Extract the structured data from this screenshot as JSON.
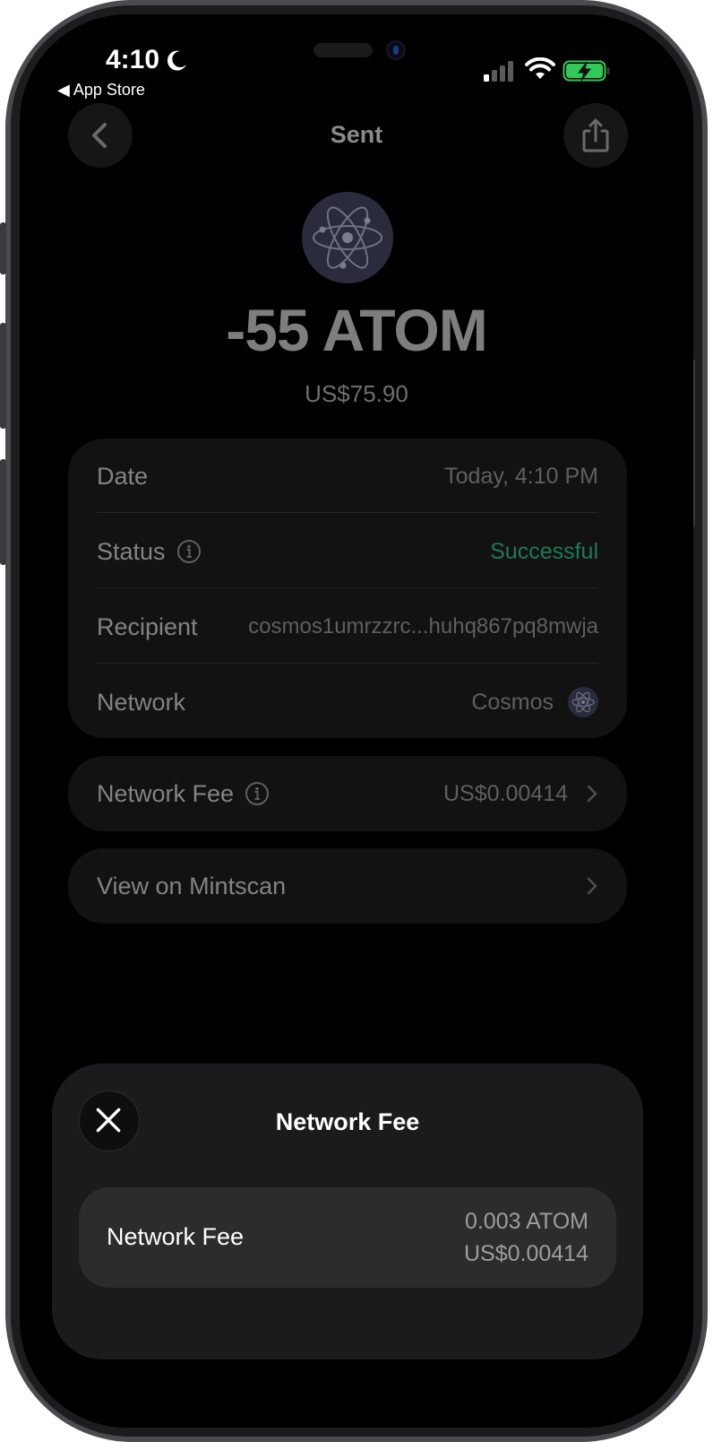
{
  "status_bar": {
    "time": "4:10",
    "back_app": "◀ App Store",
    "battery_color": "#34c759"
  },
  "header": {
    "title": "Sent"
  },
  "transaction": {
    "amount": "-55 ATOM",
    "fiat_amount": "US$75.90"
  },
  "details": {
    "date_label": "Date",
    "date_value": "Today, 4:10 PM",
    "status_label": "Status",
    "status_value": "Successful",
    "status_color": "#1e7a55",
    "recipient_label": "Recipient",
    "recipient_value": "cosmos1umrzzrc...huhq867pq8mwja",
    "network_label": "Network",
    "network_value": "Cosmos"
  },
  "fee_row": {
    "label": "Network Fee",
    "value": "US$0.00414"
  },
  "explorer_row": {
    "label": "View on Mintscan"
  },
  "sheet": {
    "title": "Network Fee",
    "fee_label": "Network Fee",
    "fee_atom": "0.003 ATOM",
    "fee_usd": "US$0.00414"
  }
}
